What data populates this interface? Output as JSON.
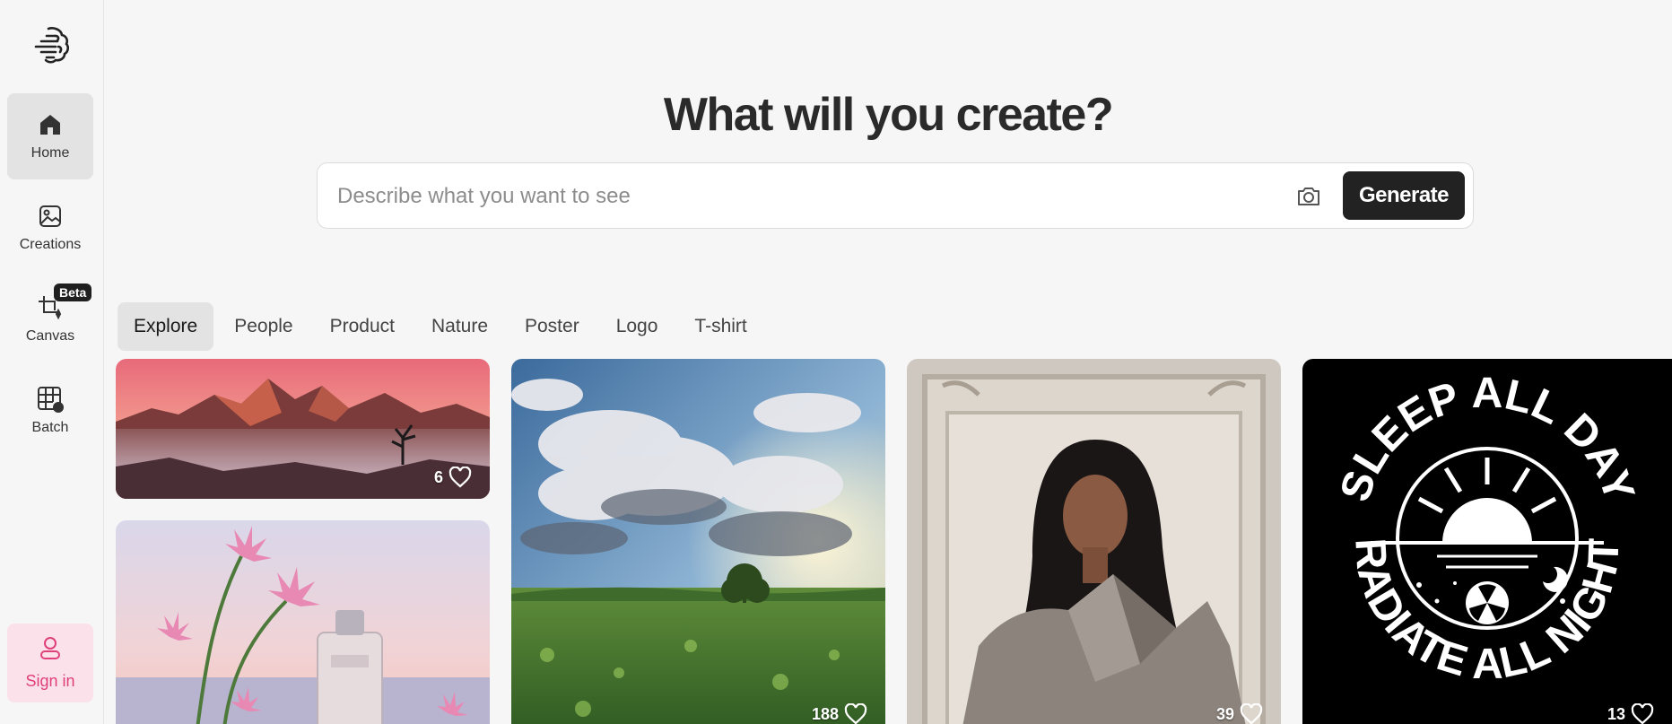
{
  "sidebar": {
    "logo": "brain-logo-icon",
    "items": [
      {
        "label": "Home",
        "icon": "home-icon",
        "active": true
      },
      {
        "label": "Creations",
        "icon": "image-icon",
        "active": false
      },
      {
        "label": "Canvas",
        "icon": "canvas-crop-icon",
        "active": false,
        "badge": "Beta"
      },
      {
        "label": "Batch",
        "icon": "batch-grid-icon",
        "active": false
      }
    ],
    "signin": {
      "label": "Sign in",
      "icon": "user-icon"
    }
  },
  "hero": {
    "title": "What will you create?"
  },
  "search": {
    "placeholder": "Describe what you want to see",
    "value": "",
    "camera_icon": "camera-icon",
    "generate_label": "Generate"
  },
  "tabs": [
    {
      "label": "Explore",
      "active": true
    },
    {
      "label": "People",
      "active": false
    },
    {
      "label": "Product",
      "active": false
    },
    {
      "label": "Nature",
      "active": false
    },
    {
      "label": "Poster",
      "active": false
    },
    {
      "label": "Logo",
      "active": false
    },
    {
      "label": "T-shirt",
      "active": false
    }
  ],
  "gallery": [
    {
      "subject": "pink sunset desert mountains in fog",
      "likes": "6"
    },
    {
      "subject": "cloudy sky over green meadow with tree",
      "likes": "188"
    },
    {
      "subject": "woman in oversized taupe leather coat before ornate frame",
      "likes": "39"
    },
    {
      "subject": "t-shirt graphic",
      "likes": "13",
      "text_top": "SLEEP ALL DAY",
      "text_bottom": "RADIATE ALL NIGHT"
    },
    {
      "subject": "pink lilies and perfume bottle",
      "likes": ""
    }
  ],
  "colors": {
    "background": "#f6f6f6",
    "accent_dark": "#222222",
    "signin_bg": "#fbe2ea",
    "signin_text": "#e0407a"
  }
}
